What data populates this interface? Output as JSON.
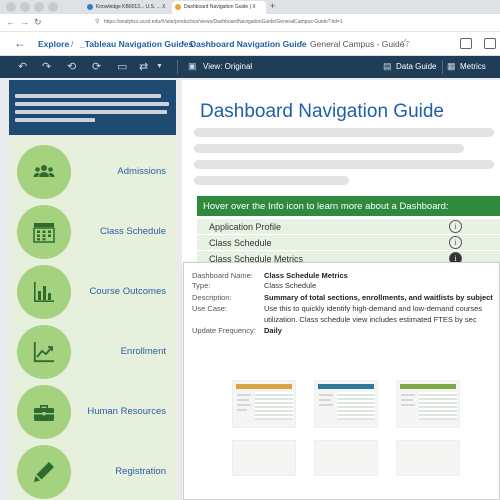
{
  "browser": {
    "tabs": [
      {
        "title": "Knowledge KB0013... U.S. ... X"
      },
      {
        "title": "Dashboard Navigation Guide | X"
      }
    ],
    "new_tab": "+",
    "url": "https://analytics.ucsd.edu/#/site/production/views/DashboardNavigationGuide/GeneralCampus-Guide?:iid=1"
  },
  "breadcrumb": {
    "items": [
      {
        "label": "Explore"
      },
      {
        "label": "_Tableau Navigation Guides"
      },
      {
        "label": "Dashboard Navigation Guide"
      }
    ],
    "separator": "/",
    "current": "General Campus - Guide"
  },
  "toolbar": {
    "view_label": "View: Original",
    "data_guide_label": "Data Guide",
    "metrics_label": "Metrics"
  },
  "sidebar": {
    "items": [
      {
        "label": "Admissions",
        "icon": "people-icon"
      },
      {
        "label": "Class Schedule",
        "icon": "calendar-icon"
      },
      {
        "label": "Course Outcomes",
        "icon": "bar-chart-icon"
      },
      {
        "label": "Enrollment",
        "icon": "trend-chart-icon"
      },
      {
        "label": "Human Resources",
        "icon": "briefcase-icon"
      },
      {
        "label": "Registration",
        "icon": "pen-icon"
      }
    ]
  },
  "main": {
    "title": "Dashboard Navigation Guide",
    "banner": "Hover over the Info icon to learn more about a Dashboard:",
    "list": [
      {
        "label": "Application Profile"
      },
      {
        "label": "Class Schedule"
      },
      {
        "label": "Class Schedule Metrics"
      }
    ]
  },
  "tooltip": {
    "rows": [
      {
        "key": "Dashboard Name:",
        "value": "Class Schedule Metrics"
      },
      {
        "key": "Type:",
        "value": "Class Schedule"
      },
      {
        "key": "Description:",
        "value": "Summary of total sections, enrollments, and waitlists by subject"
      },
      {
        "key": "Use Case:",
        "value": "Use this to quickly identify high-demand and low-demand courses"
      },
      {
        "key": "",
        "value": "utilization.  Class schedule view includes estimated FTES by sec"
      },
      {
        "key": "Update Frequency:",
        "value": "Daily"
      }
    ]
  },
  "colors": {
    "accent": "#1f5fa8",
    "toolbar_bg": "#1f3d57",
    "sidebar_header": "#1f4b73",
    "sidebar_bg": "#e6f0dc",
    "icon_circle": "#a4d27e",
    "banner": "#2f8a3e"
  }
}
